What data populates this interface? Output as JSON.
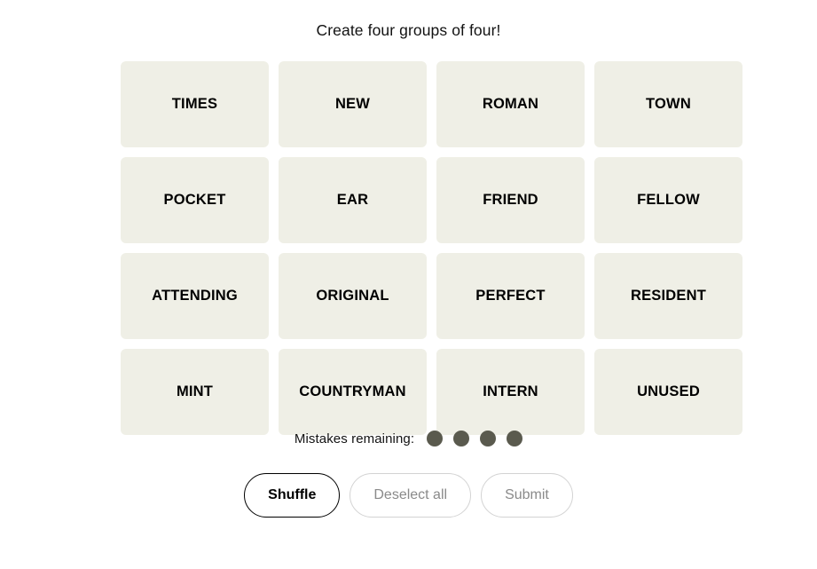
{
  "page": {
    "background_color": "#ffffff",
    "title": "Create four groups of four!"
  },
  "board": {
    "tile_color": "#efefe6",
    "tile_text_color": "#000000",
    "rows": [
      [
        "TIMES",
        "NEW",
        "ROMAN",
        "TOWN"
      ],
      [
        "POCKET",
        "EAR",
        "FRIEND",
        "FELLOW"
      ],
      [
        "ATTENDING",
        "ORIGINAL",
        "PERFECT",
        "RESIDENT"
      ],
      [
        "MINT",
        "COUNTRYMAN",
        "INTERN",
        "UNUSED"
      ]
    ],
    "tiles": [
      "TIMES",
      "NEW",
      "ROMAN",
      "TOWN",
      "POCKET",
      "EAR",
      "FRIEND",
      "FELLOW",
      "ATTENDING",
      "ORIGINAL",
      "PERFECT",
      "RESIDENT",
      "MINT",
      "COUNTRYMAN",
      "INTERN",
      "UNUSED"
    ]
  },
  "mistakes": {
    "label": "Mistakes remaining:",
    "remaining": 4,
    "dot_color": "#5a5a4e",
    "dots": [
      "mistake-dot",
      "mistake-dot",
      "mistake-dot",
      "mistake-dot"
    ]
  },
  "controls": {
    "shuffle_label": "Shuffle",
    "deselect_label": "Deselect all",
    "submit_label": "Submit",
    "shuffle_enabled": true,
    "deselect_enabled": false,
    "submit_enabled": false,
    "enabled_border_color": "#000000",
    "disabled_border_color": "#d3d3d3",
    "disabled_text_color": "#8a8a8a"
  }
}
